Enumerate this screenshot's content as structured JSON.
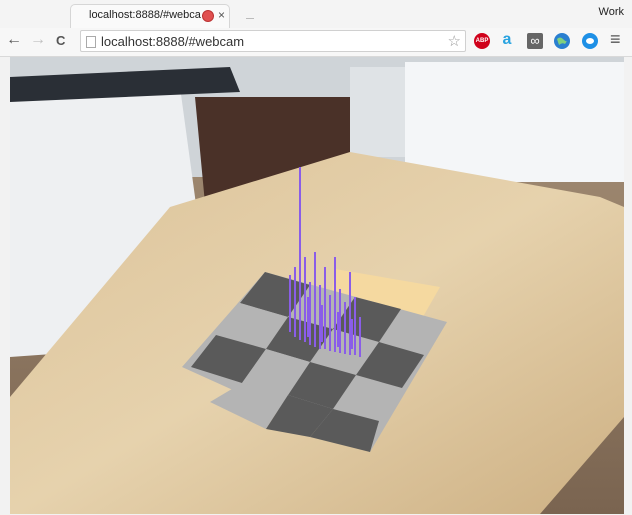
{
  "browser": {
    "tab_title": "localhost:8888/#webcam",
    "close_glyph": "×",
    "profile_name": "Work",
    "url": "localhost:8888/#webcam",
    "back_glyph": "←",
    "forward_glyph": "→",
    "reload_glyph": "C",
    "star_glyph": "☆",
    "menu_glyph": "≡",
    "extensions": {
      "adblock_text": "ABP",
      "amazon_text": "a",
      "infinity_text": "∞"
    }
  },
  "colors": {
    "toolbar_bg": "#f7f7f7",
    "recording_indicator": "#e05050",
    "adblock_red": "#d0021b",
    "bar_color": "#8a5de8",
    "board_dark": "#5a5a5a",
    "board_light": "#b4b4b4"
  },
  "icons": [
    "back-arrow-icon",
    "forward-arrow-icon",
    "reload-icon",
    "page-icon",
    "bookmark-star-icon",
    "adblock-icon",
    "amazon-icon",
    "infinity-icon",
    "earth-icon",
    "chat-icon",
    "menu-icon",
    "recording-icon",
    "close-icon"
  ]
}
